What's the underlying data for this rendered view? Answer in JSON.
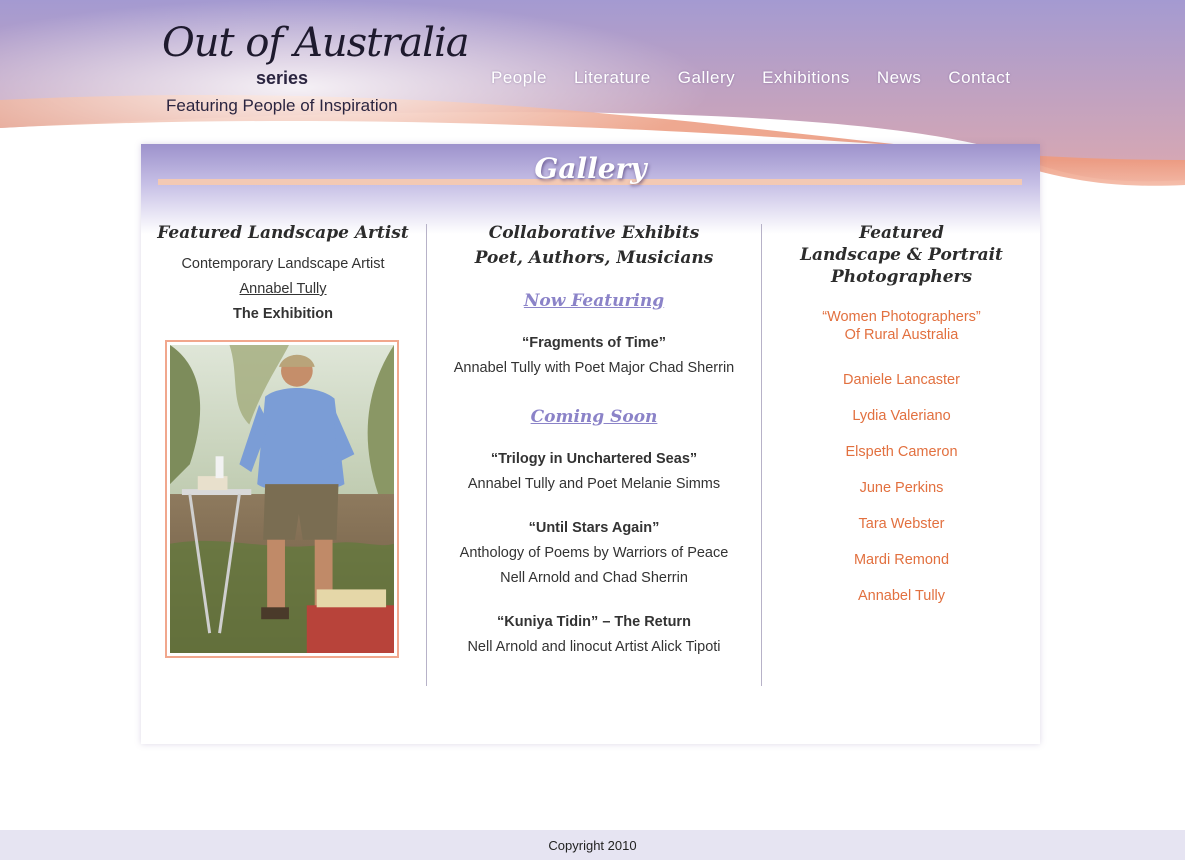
{
  "brand": {
    "script_title": "Out of Australia",
    "series_label": "series",
    "tagline": "Featuring People of Inspiration"
  },
  "nav": {
    "items": [
      {
        "label": "People"
      },
      {
        "label": "Literature"
      },
      {
        "label": "Gallery"
      },
      {
        "label": "Exhibitions"
      },
      {
        "label": "News"
      },
      {
        "label": "Contact"
      }
    ]
  },
  "page": {
    "title": "Gallery"
  },
  "col1": {
    "heading": "Featured Landscape Artist",
    "subtitle": "Contemporary Landscape Artist",
    "artist_link": "Annabel Tully",
    "exhibition": "The Exhibition"
  },
  "col2": {
    "heading_line1": "Collaborative Exhibits",
    "heading_line2": "Poet, Authors, Musicians",
    "now_featuring_label": "Now Featuring",
    "now": {
      "title": "“Fragments of Time”",
      "credit": "Annabel Tully with Poet Major Chad Sherrin"
    },
    "coming_soon_label": "Coming Soon",
    "upcoming": [
      {
        "title": "“Trilogy in Unchartered Seas”",
        "line1": "Annabel Tully and Poet Melanie Simms",
        "line2": ""
      },
      {
        "title": "“Until Stars Again”",
        "line1": "Anthology of Poems by Warriors of Peace",
        "line2": "Nell Arnold and Chad Sherrin"
      },
      {
        "title": "“Kuniya Tidin” – The Return",
        "line1": "Nell Arnold and linocut Artist Alick Tipoti",
        "line2": ""
      }
    ]
  },
  "col3": {
    "heading_line1": "Featured",
    "heading_line2": "Landscape & Portrait",
    "heading_line3": "Photographers",
    "group_line1": "“Women Photographers”",
    "group_line2": "Of Rural Australia",
    "photographers": [
      {
        "name": "Daniele Lancaster"
      },
      {
        "name": "Lydia Valeriano"
      },
      {
        "name": "Elspeth Cameron"
      },
      {
        "name": "June Perkins"
      },
      {
        "name": "Tara Webster"
      },
      {
        "name": "Mardi Remond"
      },
      {
        "name": "Annabel Tully"
      }
    ]
  },
  "footer": {
    "copyright": "Copyright 2010"
  },
  "colors": {
    "accent_purple": "#8b83c8",
    "accent_orange": "#e2703f",
    "header_sky": "#8e86c4",
    "header_peach": "#f1a78d"
  }
}
